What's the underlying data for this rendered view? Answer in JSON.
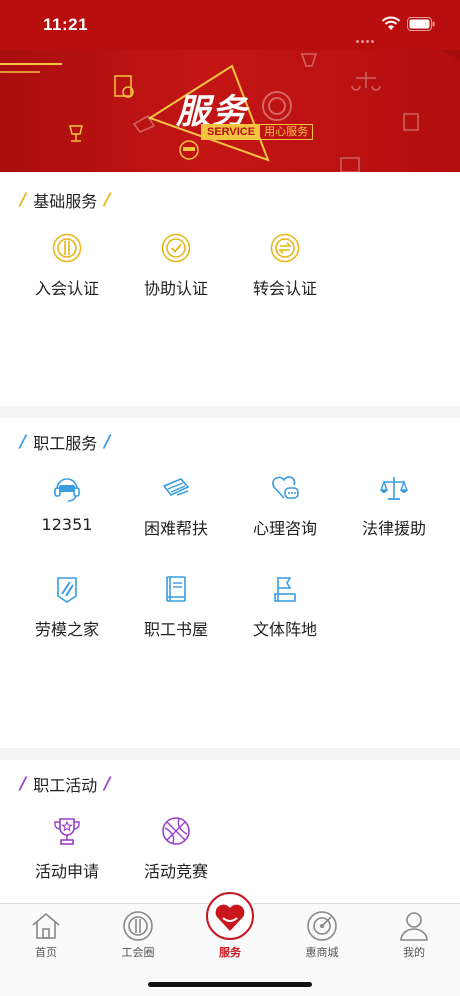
{
  "status_bar": {
    "time": "11:21"
  },
  "banner": {
    "title": "服务",
    "tag_en": "SERVICE",
    "tag_cn": "用心服务"
  },
  "sections": {
    "basic": {
      "title": "基础服务",
      "color": "#e8b61c",
      "items": [
        {
          "label": "入会认证",
          "icon": "union-badge-icon"
        },
        {
          "label": "协助认证",
          "icon": "check-badge-icon"
        },
        {
          "label": "转会认证",
          "icon": "transfer-badge-icon"
        }
      ]
    },
    "worker": {
      "title": "职工服务",
      "color": "#3a9de0",
      "items": [
        {
          "label": "12351",
          "icon": "hotline-headset-icon"
        },
        {
          "label": "困难帮扶",
          "icon": "help-hand-icon"
        },
        {
          "label": "心理咨询",
          "icon": "heart-chat-icon"
        },
        {
          "label": "法律援助",
          "icon": "scales-icon"
        },
        {
          "label": "劳模之家",
          "icon": "model-worker-icon"
        },
        {
          "label": "职工书屋",
          "icon": "book-icon"
        },
        {
          "label": "文体阵地",
          "icon": "flag-icon"
        }
      ]
    },
    "activity": {
      "title": "职工活动",
      "color": "#9b3fc9",
      "items": [
        {
          "label": "活动申请",
          "icon": "trophy-icon"
        },
        {
          "label": "活动竞赛",
          "icon": "basketball-icon"
        }
      ]
    }
  },
  "tabbar": {
    "items": [
      {
        "label": "首页",
        "icon": "home-icon",
        "active": false
      },
      {
        "label": "工会圈",
        "icon": "union-circle-icon",
        "active": false
      },
      {
        "label": "服务",
        "icon": "heart-icon",
        "active": true
      },
      {
        "label": "惠商城",
        "icon": "radar-icon",
        "active": false
      },
      {
        "label": "我的",
        "icon": "user-icon",
        "active": false
      }
    ]
  },
  "colors": {
    "brand_red": "#c8161d",
    "banner_gold": "#f5c342"
  }
}
